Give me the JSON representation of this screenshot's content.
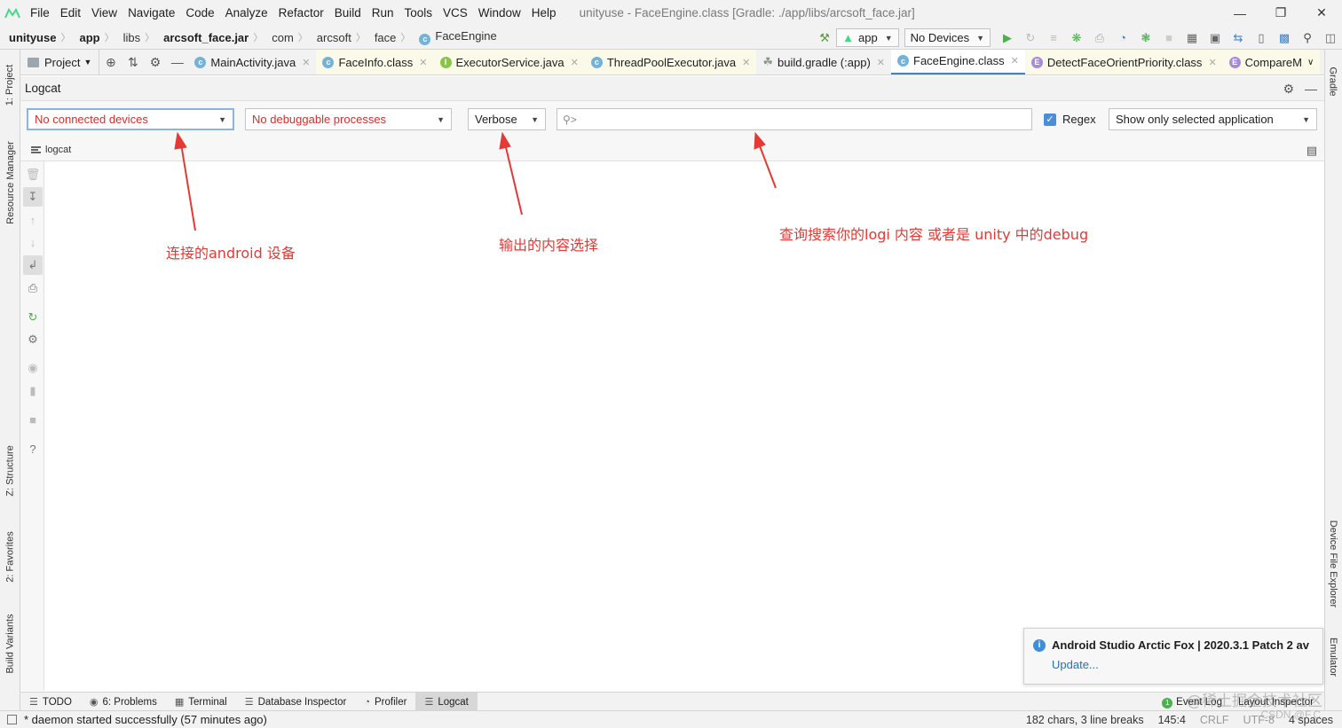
{
  "menubar": {
    "items": [
      "File",
      "Edit",
      "View",
      "Navigate",
      "Code",
      "Analyze",
      "Refactor",
      "Build",
      "Run",
      "Tools",
      "VCS",
      "Window",
      "Help"
    ],
    "window_title": "unityuse - FaceEngine.class [Gradle: ./app/libs/arcsoft_face.jar]"
  },
  "breadcrumb": {
    "items": [
      "unityuse",
      "app",
      "libs",
      "arcsoft_face.jar",
      "com",
      "arcsoft",
      "face"
    ],
    "current": "FaceEngine"
  },
  "toolbar": {
    "run_config": "app",
    "device": "No Devices"
  },
  "left_tabs": [
    "1: Project",
    "Resource Manager",
    "Z: Structure",
    "2: Favorites",
    "Build Variants"
  ],
  "right_tabs": [
    "Gradle",
    "Device File Explorer",
    "Emulator"
  ],
  "project_button": "Project",
  "editor_tabs": [
    {
      "label": "MainActivity.java",
      "kind": "C"
    },
    {
      "label": "FaceInfo.class",
      "kind": "C"
    },
    {
      "label": "ExecutorService.java",
      "kind": "I"
    },
    {
      "label": "ThreadPoolExecutor.java",
      "kind": "C"
    },
    {
      "label": "build.gradle (:app)",
      "kind": "gradle"
    },
    {
      "label": "FaceEngine.class",
      "kind": "C"
    },
    {
      "label": "DetectFaceOrientPriority.class",
      "kind": "E"
    },
    {
      "label": "CompareM",
      "kind": "E"
    }
  ],
  "logcat": {
    "title": "Logcat",
    "device_select": "No connected devices",
    "process_select": "No debuggable processes",
    "level_select": "Verbose",
    "search_placeholder": "",
    "regex_label": "Regex",
    "regex_checked": true,
    "filter_select": "Show only selected application",
    "sub_label": "logcat"
  },
  "annotations": {
    "device": "连接的android 设备",
    "level": "输出的内容选择",
    "search": "查询搜索你的logi 内容  或者是 unity 中的debug"
  },
  "notification": {
    "title": "Android Studio Arctic Fox | 2020.3.1 Patch 2 av",
    "link": "Update..."
  },
  "bottom_tools": [
    {
      "label": "TODO",
      "icon": "list-icon"
    },
    {
      "label": "6: Problems",
      "icon": "problems-icon"
    },
    {
      "label": "Terminal",
      "icon": "terminal-icon"
    },
    {
      "label": "Database Inspector",
      "icon": "database-icon"
    },
    {
      "label": "Profiler",
      "icon": "profiler-icon"
    },
    {
      "label": "Logcat",
      "icon": "logcat-icon"
    }
  ],
  "bottom_right": [
    "Event Log",
    "Layout Inspector"
  ],
  "statusbar": {
    "message": "* daemon started successfully (57 minutes ago)",
    "chars": "182 chars, 3 line breaks",
    "position": "145:4",
    "line_sep": "CRLF",
    "encoding": "UTF-8",
    "indent": "4 spaces"
  },
  "watermark": "@稀土掘金技术社区",
  "watermark2": "CSDN @F.C",
  "colors": {
    "annotation": "#e53935",
    "accent": "#4083c9",
    "error_text": "#d32f2f"
  }
}
